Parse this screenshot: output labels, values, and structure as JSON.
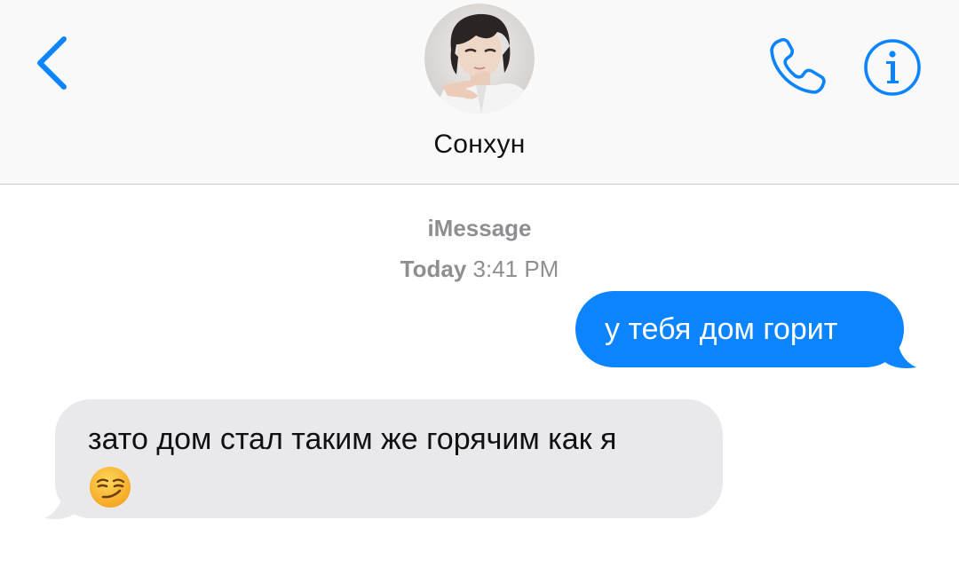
{
  "header": {
    "contact_name": "Сонхун",
    "back_icon": "chevron-left-icon",
    "phone_icon": "phone-icon",
    "info_icon": "info-icon"
  },
  "meta": {
    "service": "iMessage",
    "day": "Today",
    "time": "3:41 PM"
  },
  "messages": [
    {
      "direction": "sent",
      "text": "у тебя дом горит"
    },
    {
      "direction": "received",
      "text": "зато дом стал таким же горячим как я",
      "emoji": "smirking-face-emoji"
    }
  ],
  "colors": {
    "accent": "#0b84fe",
    "sent_bubble": "#0b84fe",
    "received_bubble": "#e9e9eb",
    "meta_text": "#8e8e93",
    "header_bg": "#f9f9f9"
  }
}
